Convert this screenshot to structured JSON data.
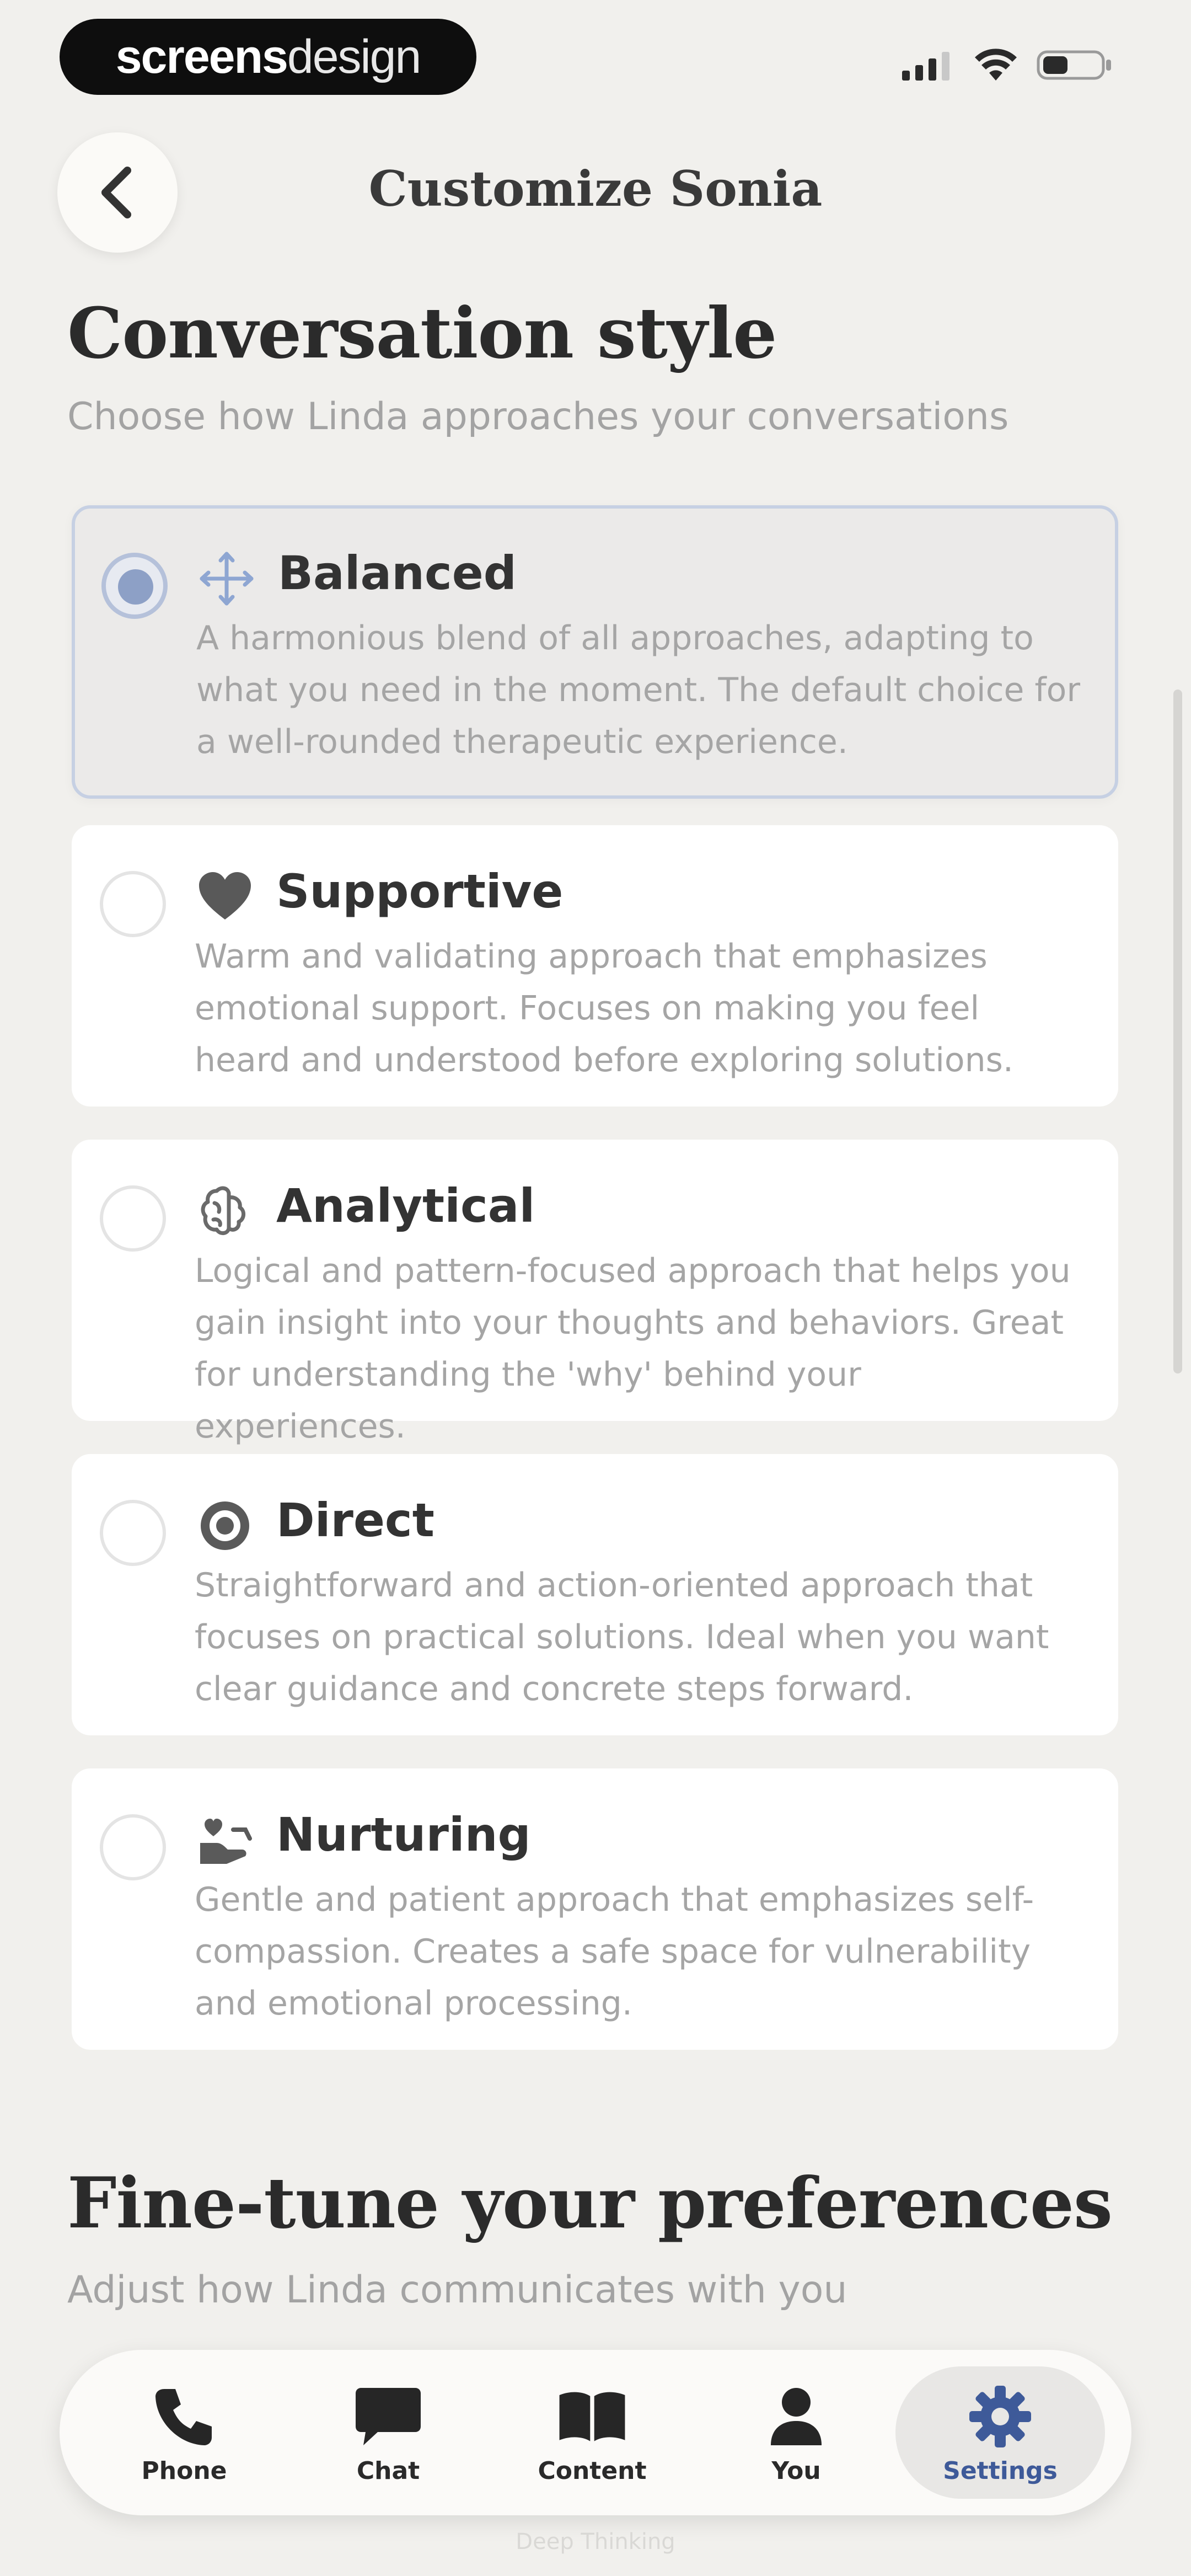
{
  "status_bar": {
    "watermark_part1": "screens",
    "watermark_part2": "design"
  },
  "header": {
    "title": "Customize Sonia"
  },
  "conversation_style": {
    "title": "Conversation style",
    "subtitle": "Choose how Linda approaches your conversations",
    "options": [
      {
        "label": "Balanced",
        "description": "A harmonious blend of all approaches, adapting to what you need in the moment. The default choice for a well-rounded therapeutic experience.",
        "icon": "balance-arrows-icon",
        "selected": true
      },
      {
        "label": "Supportive",
        "description": "Warm and validating approach that emphasizes emotional support. Focuses on making you feel heard and understood before exploring solutions.",
        "icon": "heart-icon",
        "selected": false
      },
      {
        "label": "Analytical",
        "description": "Logical and pattern-focused approach that helps you gain insight into your thoughts and behaviors. Great for understanding the 'why' behind your experiences.",
        "icon": "brain-icon",
        "selected": false
      },
      {
        "label": "Direct",
        "description": "Straightforward and action-oriented approach that focuses on practical solutions. Ideal when you want clear guidance and concrete steps forward.",
        "icon": "target-icon",
        "selected": false
      },
      {
        "label": "Nurturing",
        "description": "Gentle and patient approach that emphasizes self-compassion. Creates a safe space for vulnerability and emotional processing.",
        "icon": "hands-heart-icon",
        "selected": false
      }
    ]
  },
  "preferences": {
    "title": "Fine-tune your preferences",
    "subtitle": "Adjust how Linda communicates with you"
  },
  "tabbar": {
    "tabs": [
      {
        "label": "Phone",
        "icon": "phone-icon",
        "active": false
      },
      {
        "label": "Chat",
        "icon": "chat-icon",
        "active": false
      },
      {
        "label": "Content",
        "icon": "book-icon",
        "active": false
      },
      {
        "label": "You",
        "icon": "person-icon",
        "active": false
      },
      {
        "label": "Settings",
        "icon": "gear-icon",
        "active": true
      }
    ]
  },
  "home_indicator_text": "Deep Thinking",
  "colors": {
    "accent": "#3e5a99",
    "background": "#f1f0ed",
    "selected_border": "#c6d0e3"
  }
}
